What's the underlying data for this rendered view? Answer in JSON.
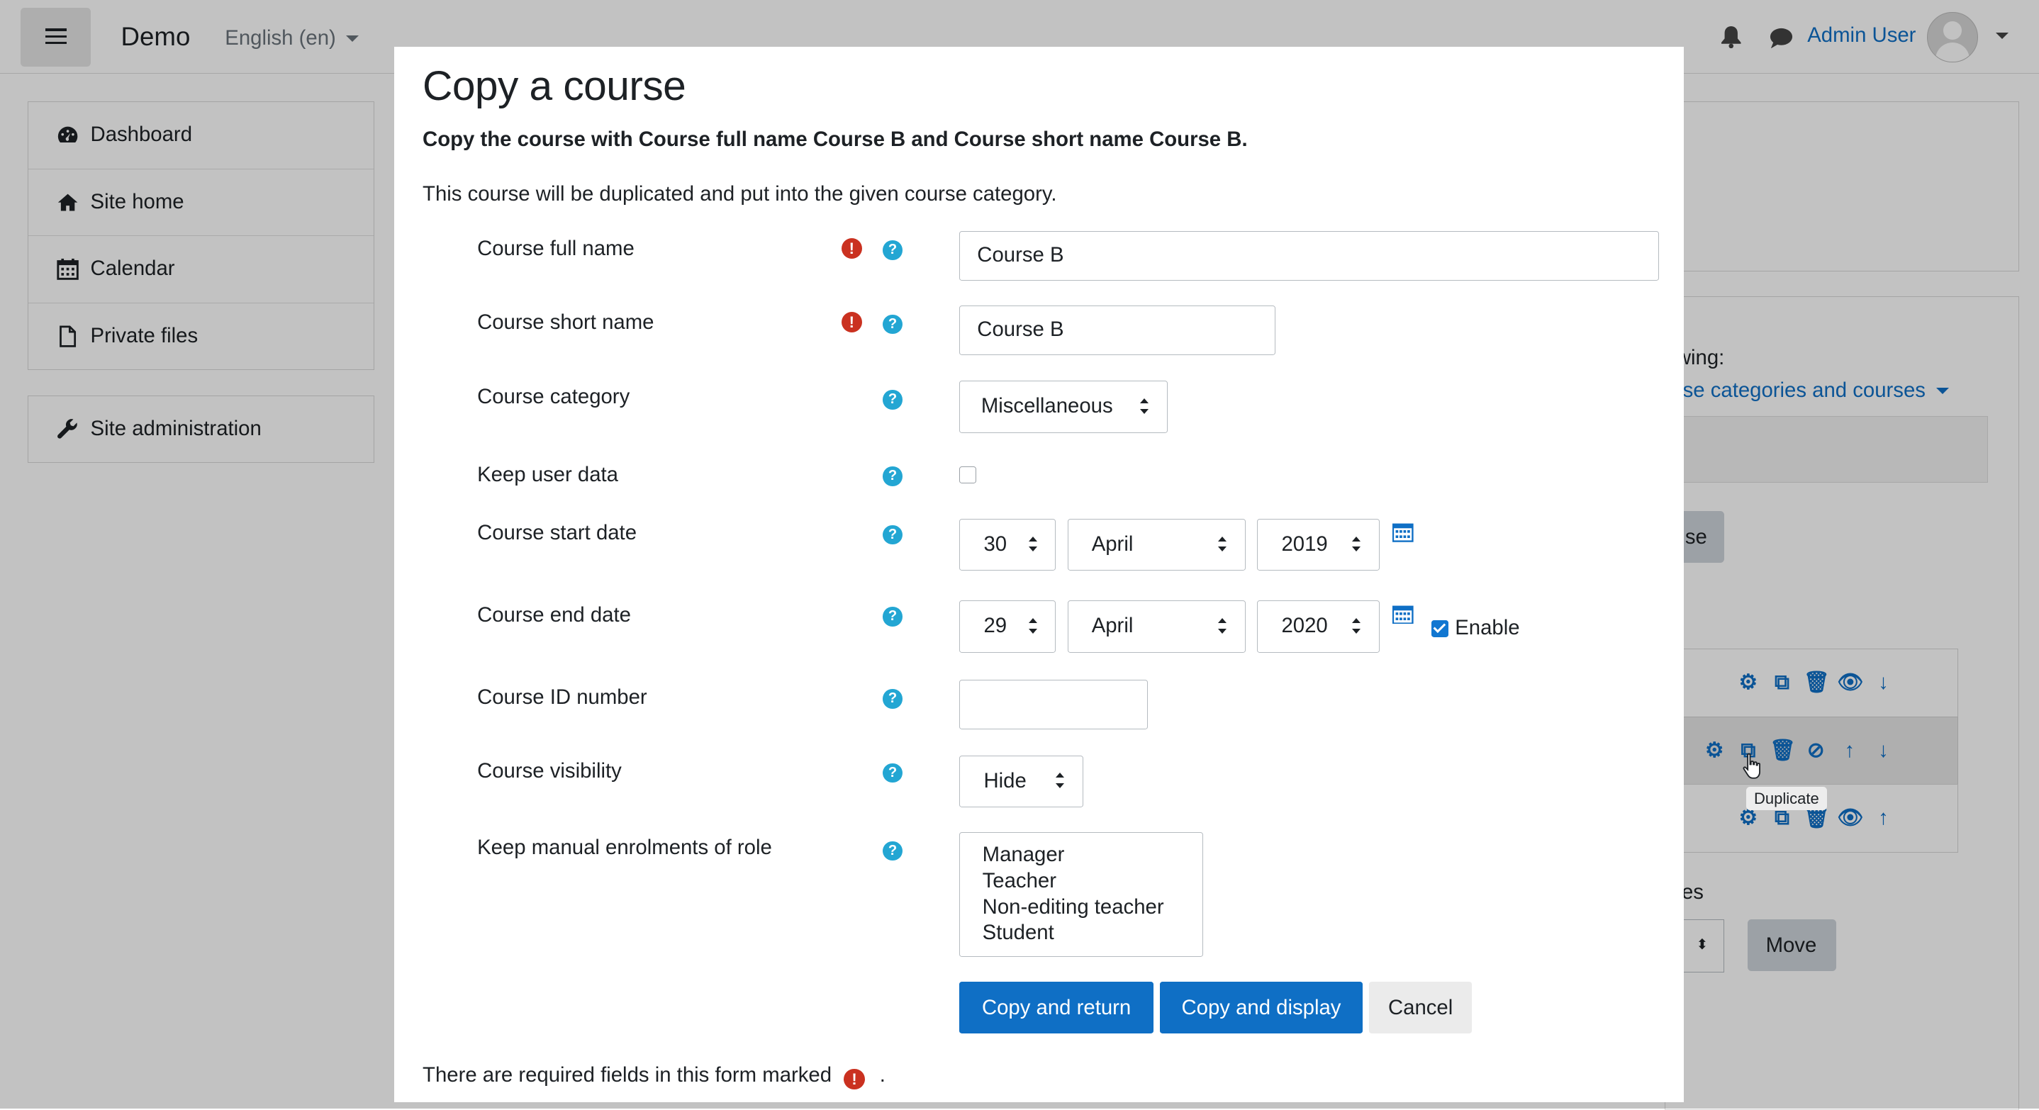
{
  "navbar": {
    "brand": "Demo",
    "language": "English (en)",
    "user_name": "Admin User"
  },
  "drawer": {
    "items": [
      {
        "label": "Dashboard",
        "icon": "dashboard-icon"
      },
      {
        "label": "Site home",
        "icon": "home-icon"
      },
      {
        "label": "Calendar",
        "icon": "calendar-icon"
      },
      {
        "label": "Private files",
        "icon": "file-icon"
      }
    ],
    "admin": {
      "label": "Site administration",
      "icon": "wrench-icon"
    }
  },
  "background": {
    "viewing_label": "ewing:",
    "viewing_link": "urse categories and courses",
    "button_fragment": "se",
    "courses_fragment": "rses",
    "move_button": "Move",
    "tooltip": "Duplicate"
  },
  "modal": {
    "title": "Copy a course",
    "intro": "Copy the course with Course full name Course B and Course short name Course B.",
    "description": "This course will be duplicated and put into the given course category.",
    "fields": {
      "fullname": {
        "label": "Course full name",
        "value": "Course B"
      },
      "shortname": {
        "label": "Course short name",
        "value": "Course B"
      },
      "category": {
        "label": "Course category",
        "value": "Miscellaneous"
      },
      "userdata": {
        "label": "Keep user data",
        "checked": false
      },
      "startdate": {
        "label": "Course start date",
        "day": "30",
        "month": "April",
        "year": "2019"
      },
      "enddate": {
        "label": "Course end date",
        "day": "29",
        "month": "April",
        "year": "2020",
        "enable_label": "Enable",
        "enabled": true
      },
      "idnumber": {
        "label": "Course ID number",
        "value": ""
      },
      "visibility": {
        "label": "Course visibility",
        "value": "Hide"
      },
      "roles": {
        "label": "Keep manual enrolments of role",
        "options": [
          "Manager",
          "Teacher",
          "Non-editing teacher",
          "Student"
        ]
      }
    },
    "buttons": {
      "copy_return": "Copy and return",
      "copy_display": "Copy and display",
      "cancel": "Cancel"
    },
    "footer": "There are required fields in this form marked",
    "footer_end": "."
  },
  "colors": {
    "primary": "#0f6fc5",
    "required": "#ca3120",
    "help": "#23a6d3"
  }
}
